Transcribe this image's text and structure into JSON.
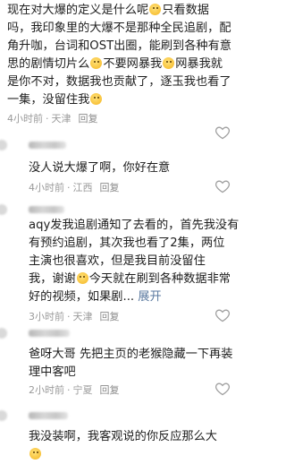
{
  "comments": [
    {
      "line1": "现在对大爆的定义是什么呢",
      "line1b": "只看数据",
      "line2": "吗，我印象里的大爆不是那种全民追剧，配",
      "line3": "角升咖，台词和OST出圈，能刷到各种有意",
      "line4a": "思的剧情切片么",
      "line4b": "不要网暴我",
      "line4c": "网暴我就",
      "line5": "是你不对，数据我也贡献了，逐玉我也看了",
      "line6": "一集，没留住我",
      "time": "4小时前",
      "location": "天津",
      "reply": "回复"
    },
    {
      "line1": "没人说大爆了啊，你好在意",
      "time": "4小时前",
      "location": "江西",
      "reply": "回复"
    },
    {
      "line1": "aqy发我追剧通知了去看的，首先我没有",
      "line2": "有预约追剧，其次我也看了2集，两位",
      "line3": "主演也很喜欢，但是我目前没留住",
      "line4": "我，谢谢",
      "line4b": "今天就在刷到各种数据非常",
      "line5": "好的视频，如果剧...",
      "expand": "展开",
      "time": "3小时前",
      "location": "天津",
      "reply": "回复"
    },
    {
      "line1": "爸呀大哥 先把主页的老猴隐藏一下再装",
      "line2": "理中客吧",
      "time": "2小时前",
      "location": "宁夏",
      "reply": "回复"
    },
    {
      "line1": "我没装啊，我客观说的你反应那么大",
      "time": "",
      "location": "",
      "reply": ""
    }
  ],
  "icons": {
    "like": "heart-outline-icon",
    "emoji": "smiley-emoji-icon"
  },
  "colors": {
    "text": "#1e1e1e",
    "meta": "#9a9a9a",
    "blue_link": "#5b7aa0"
  }
}
